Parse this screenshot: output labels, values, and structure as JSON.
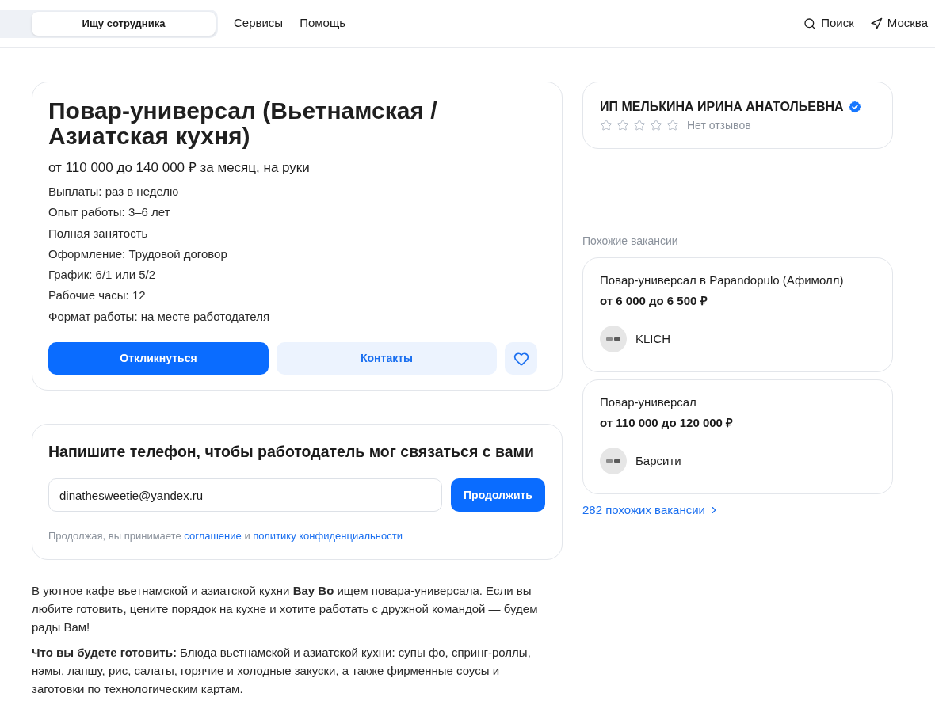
{
  "header": {
    "mode_tabs": [
      {
        "label": "Ищу сотрудника",
        "selected": true
      }
    ],
    "nav": [
      "Сервисы",
      "Помощь"
    ],
    "actions": [
      {
        "kind": "search",
        "label": "Поиск"
      },
      {
        "kind": "location",
        "label": "Москва"
      }
    ]
  },
  "vacancy": {
    "title": "Повар-универсал (Вьетнамская / Азиатская кухня)",
    "salary": "от 110 000 до 140 000 ₽ за месяц, на руки",
    "details": [
      "Выплаты: раз в неделю",
      "Опыт работы: 3–6 лет",
      "Полная занятость",
      "Оформление: Трудовой договор",
      "График: 6/1 или 5/2",
      "Рабочие часы: 12",
      "Формат работы: на месте работодателя"
    ],
    "buttons": [
      {
        "kind": "primary",
        "label": "Откликнуться"
      },
      {
        "kind": "secondary",
        "label": "Контакты"
      }
    ],
    "favorite": {
      "selected": false
    }
  },
  "phone_form": {
    "heading": "Напишите телефон, чтобы работодатель мог связаться с вами",
    "input": {
      "value": "dinathesweetie@yandex.ru"
    },
    "button": "Продолжить",
    "consent": [
      {
        "kind": "text",
        "text": "Продолжая, вы принимаете"
      },
      {
        "kind": "link",
        "text": "соглашение"
      },
      {
        "kind": "text",
        "text": "и"
      },
      {
        "kind": "link",
        "text": "политику конфиденциальности"
      }
    ]
  },
  "description": [
    "В уютное кафе вьетнамской и азиатской кухни **Bay Bo** ищем повара-универсала. Если вы любите готовить, цените порядок на кухне и хотите работать с дружной командой — будем рады Вам!",
    "**Что вы будете готовить:** Блюда вьетнамской и азиатской кухни: супы фо, спринг-роллы, нэмы, лапшу, рис, салаты, горячие и холодные закуски, а также фирменные соусы и заготовки по технологическим картам."
  ],
  "employer": {
    "name": "ИП МЕЛЬКИНА ИРИНА АНАТОЛЬЕВНА",
    "verified": true,
    "stars": 0,
    "reviews": "Нет отзывов"
  },
  "similar": {
    "heading": "Похожие вакансии",
    "items": [
      {
        "title": "Повар-универсал в Papandopulo (Афимолл)",
        "salary": "от 6 000 до 6 500 ₽",
        "company": "KLICH"
      },
      {
        "title": "Повар-универсал",
        "salary": "от 110 000 до 120 000 ₽",
        "company": "Барсити"
      }
    ],
    "more_link": "282 похожих вакансии"
  }
}
